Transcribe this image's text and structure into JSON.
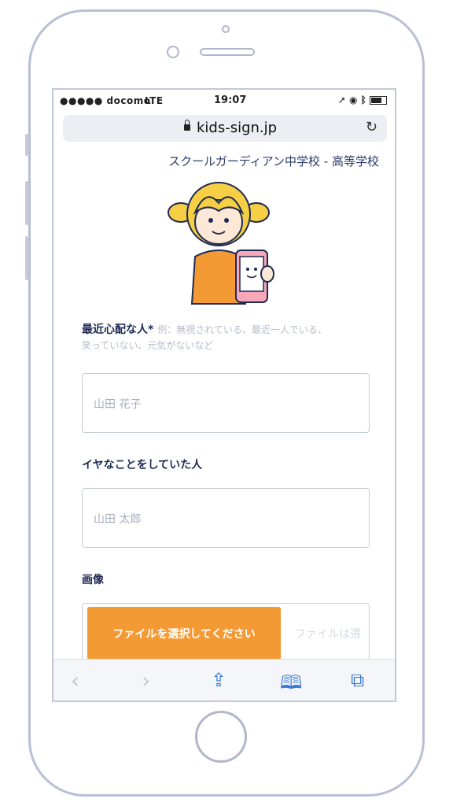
{
  "status_bar": {
    "signal": "●●●●● docomo",
    "network": "LTE",
    "time": "19:07"
  },
  "browser": {
    "url": "kids-sign.jp"
  },
  "page": {
    "school_name": "スクールガーディアン中学校 - 高等学校",
    "field1": {
      "label": "最近心配な人",
      "required_mark": "*",
      "hint_line1": "例：無視されている、最近一人でいる、",
      "hint_line2": "笑っていない、元気がないなど",
      "placeholder": "山田 花子"
    },
    "field2": {
      "label": "イヤなことをしていた人",
      "placeholder": "山田 太郎"
    },
    "field3": {
      "label": "画像",
      "button": "ファイルを選択してください",
      "file_status": "ファイルは選"
    }
  },
  "toolbar": {
    "icons": [
      "back-icon",
      "forward-icon",
      "share-icon",
      "bookmarks-icon",
      "tabs-icon"
    ]
  },
  "colors": {
    "accent": "#f39a35",
    "link": "#3a7bd5",
    "text": "#1e2a52"
  }
}
